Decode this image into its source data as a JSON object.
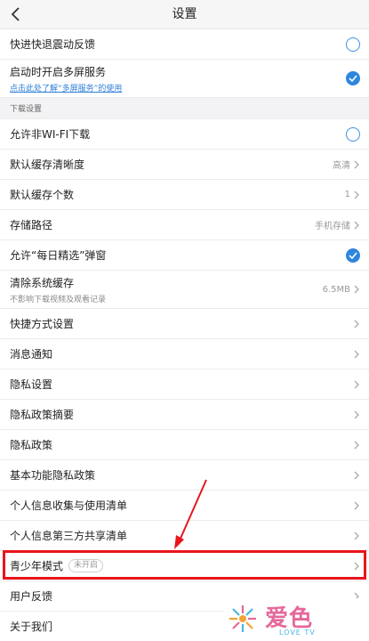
{
  "header": {
    "title": "设置"
  },
  "rows_top": [
    {
      "label": "快进快退震动反馈",
      "control": "circle"
    },
    {
      "label": "启动时开启多屏服务",
      "sub_link": "点击此处了解“多屏服务”的使用",
      "control": "check"
    }
  ],
  "download_section": {
    "title": "下载设置"
  },
  "download_rows": [
    {
      "label": "允许非WI-FI下载",
      "control": "circle"
    },
    {
      "label": "默认缓存清晰度",
      "value": "高清"
    },
    {
      "label": "默认缓存个数",
      "value": "1"
    },
    {
      "label": "存储路径",
      "value": "手机存储"
    },
    {
      "label": "允许“每日精选”弹窗",
      "control": "check"
    },
    {
      "label": "清除系统缓存",
      "sub": "不影响下载视频及观看记录",
      "value": "6.5MB"
    }
  ],
  "menu_rows": [
    {
      "label": "快捷方式设置"
    },
    {
      "label": "消息通知"
    },
    {
      "label": "隐私设置"
    },
    {
      "label": "隐私政策摘要"
    },
    {
      "label": "隐私政策"
    },
    {
      "label": "基本功能隐私政策"
    },
    {
      "label": "个人信息收集与使用清单"
    },
    {
      "label": "个人信息第三方共享清单"
    },
    {
      "label": "青少年模式",
      "badge": "未开启"
    },
    {
      "label": "用户反馈"
    },
    {
      "label": "关于我们"
    }
  ],
  "watermark": {
    "text": "爱色",
    "sub": "LOVE TV"
  },
  "colors": {
    "accent": "#2f86dc",
    "highlight": "#e8151b"
  }
}
